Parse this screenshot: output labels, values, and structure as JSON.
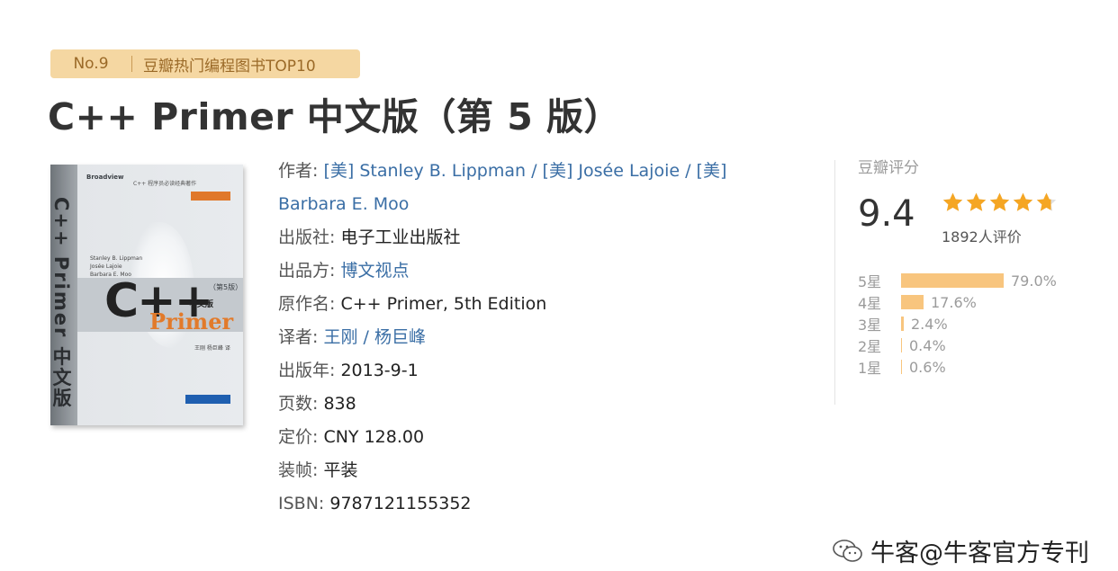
{
  "badge": {
    "rank": "No.9",
    "list": "豆瓣热门编程图书TOP10"
  },
  "book": {
    "title": "C++ Primer 中文版（第 5 版）",
    "cover": {
      "spine": "C++ Primer 中文版",
      "publisher_mark": "Broadview",
      "tagline": "C++ 程序员必读经典著作",
      "band_label": "（第5版）",
      "title_main": "C++",
      "title_cn": "中文版",
      "title_sub": "Primer",
      "authors": "Stanley B. Lippman\nJosée Lajoie\nBarbara E. Moo",
      "translators": "王刚 杨巨峰 译"
    },
    "details": {
      "author_label": "作者:",
      "author_1": "[美] Stanley B. Lippman",
      "sep": " / ",
      "author_2": "[美] Josée Lajoie",
      "author_3_prefix": "[美]",
      "author_3": "Barbara E. Moo",
      "publisher_label": "出版社:",
      "publisher": "电子工业出版社",
      "producer_label": "出品方:",
      "producer": "博文视点",
      "original_title_label": "原作名:",
      "original_title": "C++ Primer, 5th Edition",
      "translator_label": "译者:",
      "translator_1": "王刚",
      "translator_2": "杨巨峰",
      "pubdate_label": "出版年:",
      "pubdate": "2013-9-1",
      "pages_label": "页数:",
      "pages": "838",
      "price_label": "定价:",
      "price": "CNY 128.00",
      "binding_label": "装帧:",
      "binding": "平装",
      "isbn_label": "ISBN:",
      "isbn": "9787121155352"
    }
  },
  "rating": {
    "label": "豆瓣评分",
    "score": "9.4",
    "stars_value": 4.7,
    "votes": "1892人评价",
    "accent_color": "#f5a623",
    "bar_color": "#f8c57e",
    "histogram": [
      {
        "label": "5星",
        "percent": 79.0,
        "text": "79.0%"
      },
      {
        "label": "4星",
        "percent": 17.6,
        "text": "17.6%"
      },
      {
        "label": "3星",
        "percent": 2.4,
        "text": "2.4%"
      },
      {
        "label": "2星",
        "percent": 0.4,
        "text": "0.4%"
      },
      {
        "label": "1星",
        "percent": 0.6,
        "text": "0.6%"
      }
    ]
  },
  "watermark": {
    "icon": "wechat-icon",
    "text": "牛客@牛客官方专刊"
  }
}
